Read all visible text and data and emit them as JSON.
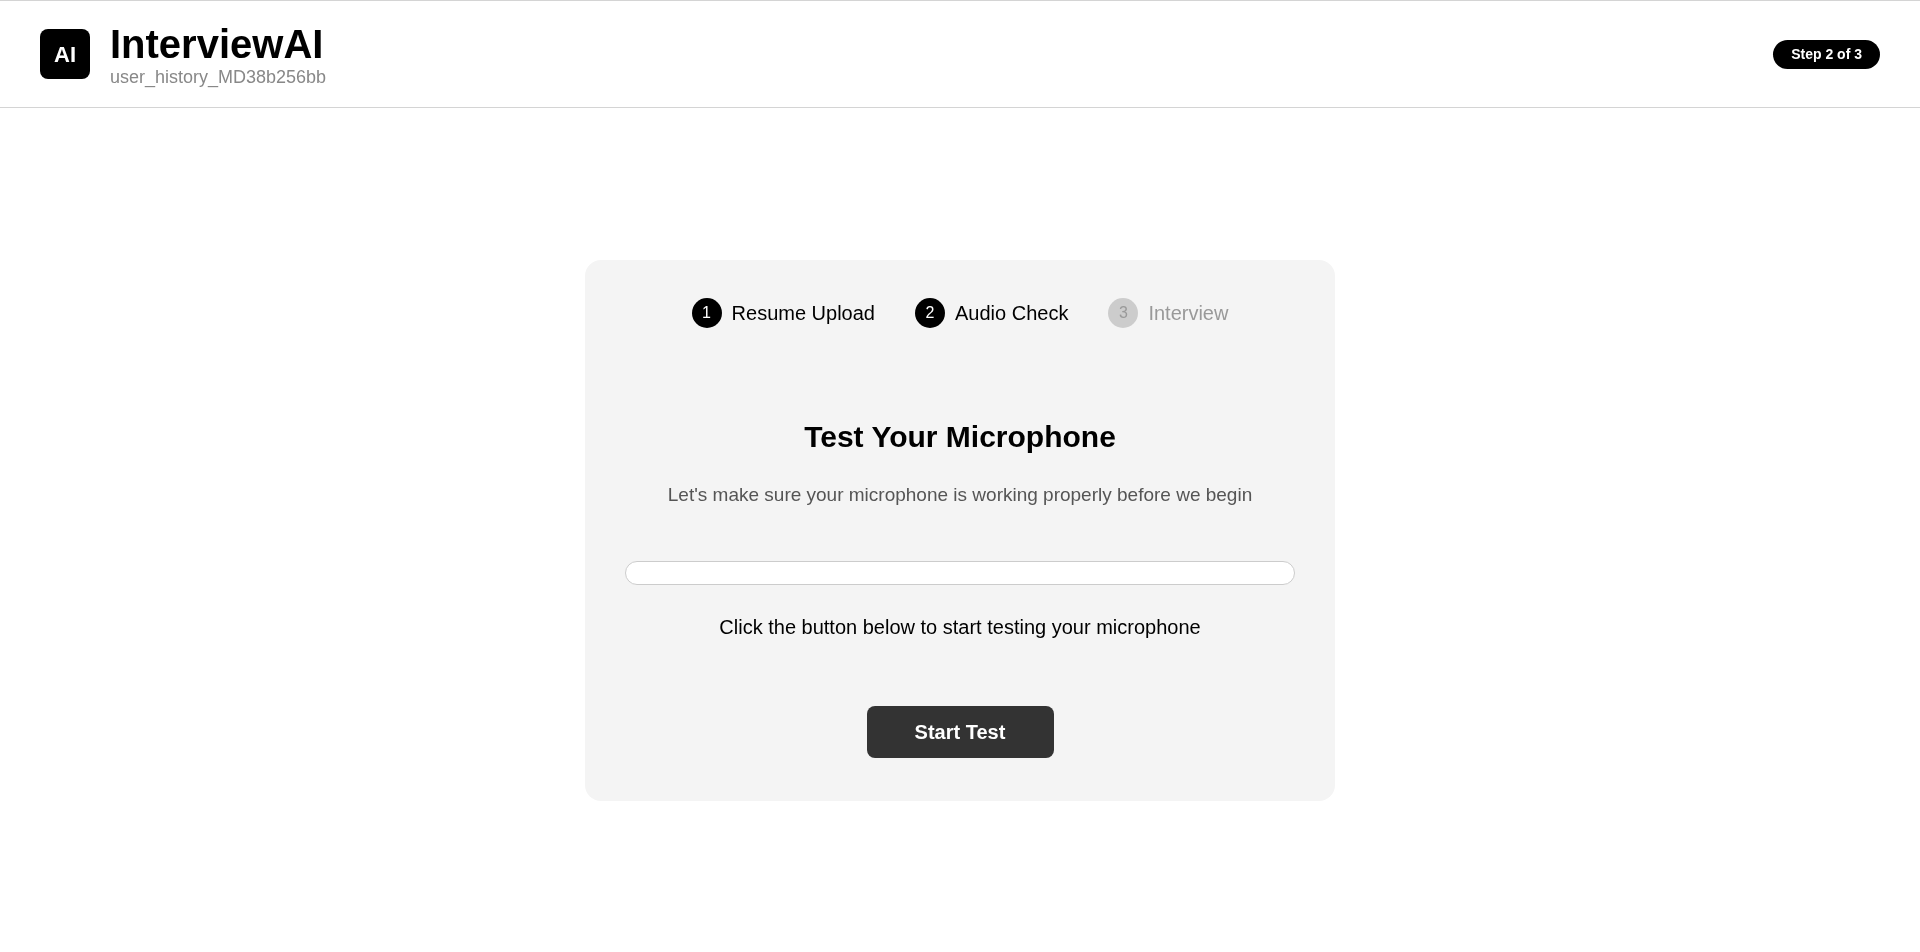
{
  "header": {
    "logo": "AI",
    "title": "InterviewAI",
    "subtitle": "user_history_MD38b256bb",
    "badge": "Step 2 of 3"
  },
  "steps": [
    {
      "number": "1",
      "label": "Resume Upload",
      "active": true
    },
    {
      "number": "2",
      "label": "Audio Check",
      "active": true
    },
    {
      "number": "3",
      "label": "Interview",
      "active": false
    }
  ],
  "card": {
    "title": "Test Your Microphone",
    "description": "Let's make sure your microphone is working properly before we begin",
    "hint": "Click the button below to start testing your microphone",
    "button": "Start Test"
  }
}
